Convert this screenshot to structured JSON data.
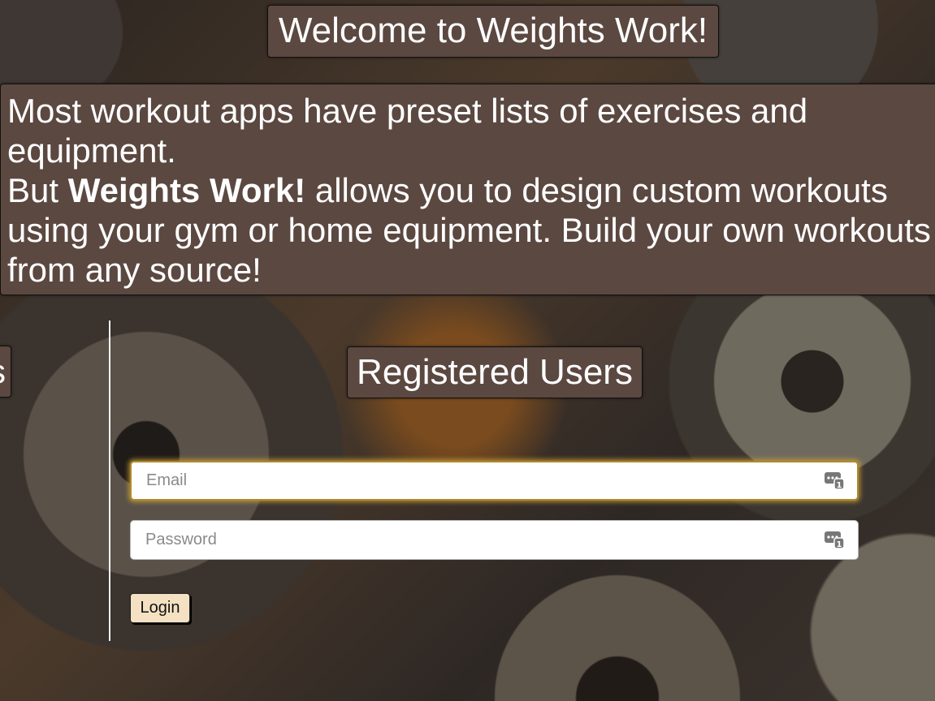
{
  "header": {
    "welcome_title": "Welcome to Weights Work!"
  },
  "intro": {
    "line1": "Most workout apps have preset lists of exercises and equipment.",
    "line2_prefix": "But ",
    "app_name": "Weights Work!",
    "line2_suffix": " allows you to design custom workouts using your gym or home equipment. Build your own workouts from any source!"
  },
  "left_panel": {
    "tab_text_fragment": "s"
  },
  "login": {
    "title": "Registered Users",
    "email_placeholder": "Email",
    "email_value": "",
    "password_placeholder": "Password",
    "password_value": "",
    "field_icon": "password-manager-key-icon",
    "button_label": "Login"
  },
  "colors": {
    "panel_bg": "#5b4841",
    "button_bg": "#f4e1c2",
    "focus_glow": "#d6aa3c"
  }
}
